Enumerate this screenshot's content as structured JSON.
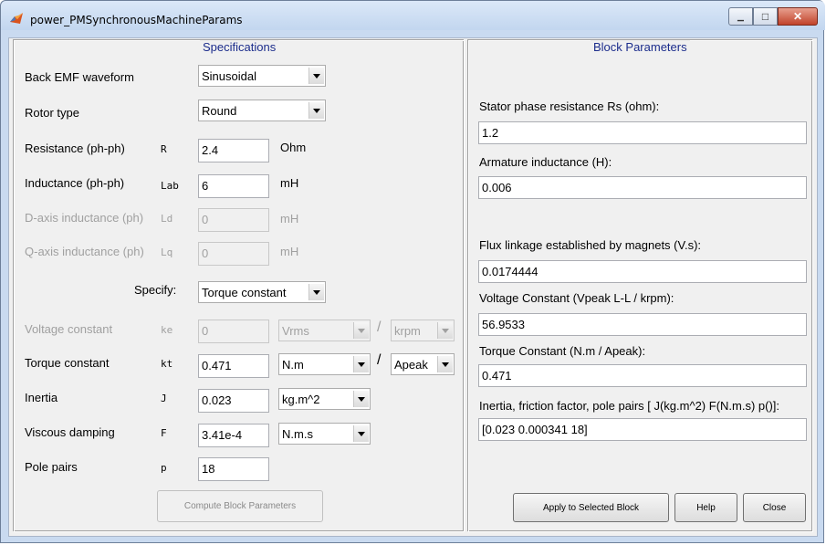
{
  "window": {
    "title": "power_PMSynchronousMachineParams",
    "minimize_glyph": "▁",
    "maximize_glyph": "□",
    "close_glyph": "✕"
  },
  "specifications": {
    "title": "Specifications",
    "back_emf": {
      "label": "Back EMF waveform",
      "value": "Sinusoidal"
    },
    "rotor_type": {
      "label": "Rotor type",
      "value": "Round"
    },
    "resistance": {
      "label": "Resistance (ph-ph)",
      "symbol": "R",
      "value": "2.4",
      "unit": "Ohm"
    },
    "inductance": {
      "label": "Inductance (ph-ph)",
      "symbol": "Lab",
      "value": "6",
      "unit": "mH"
    },
    "d_axis": {
      "label": "D-axis inductance (ph)",
      "symbol": "Ld",
      "value": "0",
      "unit": "mH"
    },
    "q_axis": {
      "label": "Q-axis inductance (ph)",
      "symbol": "Lq",
      "value": "0",
      "unit": "mH"
    },
    "specify": {
      "label": "Specify:",
      "value": "Torque constant"
    },
    "voltage_constant": {
      "label": "Voltage constant",
      "symbol": "ke",
      "value": "0",
      "unit1": "Vrms",
      "slash": "/",
      "unit2": "krpm"
    },
    "torque_constant": {
      "label": "Torque constant",
      "symbol": "kt",
      "value": "0.471",
      "unit1": "N.m",
      "slash": "/",
      "unit2": "Apeak"
    },
    "inertia": {
      "label": "Inertia",
      "symbol": "J",
      "value": "0.023",
      "unit": "kg.m^2"
    },
    "viscous": {
      "label": "Viscous damping",
      "symbol": "F",
      "value": "3.41e-4",
      "unit": "N.m.s"
    },
    "pole_pairs": {
      "label": "Pole pairs",
      "symbol": "p",
      "value": "18"
    },
    "compute_button": "Compute Block Parameters"
  },
  "block_parameters": {
    "title": "Block Parameters",
    "stator_resistance": {
      "label": "Stator phase resistance Rs (ohm):",
      "value": "1.2"
    },
    "armature_inductance": {
      "label": "Armature inductance (H):",
      "value": "0.006"
    },
    "flux_linkage": {
      "label": "Flux linkage established by magnets (V.s):",
      "value": "0.0174444"
    },
    "voltage_constant": {
      "label": "Voltage Constant (Vpeak L-L / krpm):",
      "value": "56.9533"
    },
    "torque_constant": {
      "label": "Torque Constant (N.m / Apeak):",
      "value": "0.471"
    },
    "inertia_friction": {
      "label": "Inertia, friction factor, pole pairs [ J(kg.m^2)  F(N.m.s)  p()]:",
      "value": "[0.023 0.000341 18]"
    },
    "apply_button": "Apply to Selected Block",
    "help_button": "Help",
    "close_button": "Close"
  },
  "colors": {
    "panel_title": "#1c2d8c",
    "disabled_text": "#a0a0a0",
    "window_frame": "#c9daf0"
  }
}
